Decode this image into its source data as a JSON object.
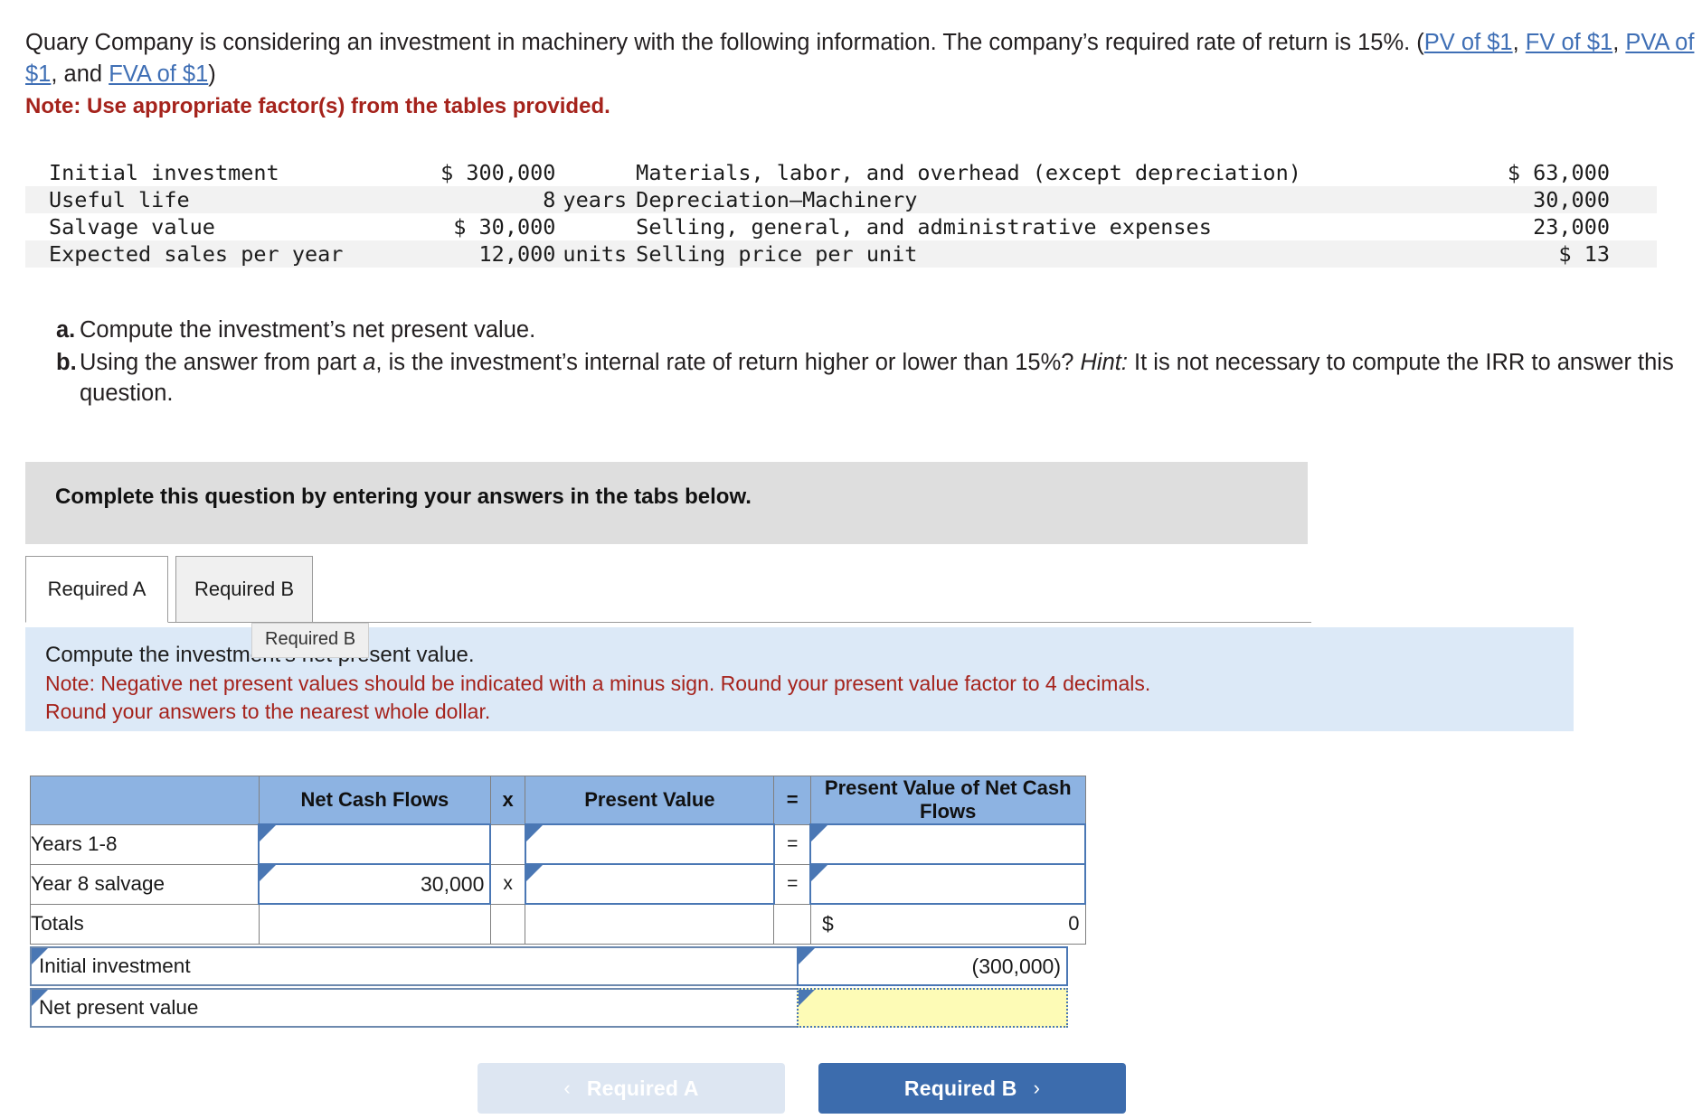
{
  "intro": {
    "part1": "Quary Company is considering an investment in machinery with the following information. The company’s required rate of return is 15%. (",
    "links": [
      "PV of $1",
      "FV of $1",
      "PVA of $1",
      "FVA of $1"
    ],
    "sep1": ", ",
    "sep2": ", ",
    "sep3": ", and ",
    "part2": ")",
    "note": "Note: Use appropriate factor(s) from the tables provided."
  },
  "facts": [
    {
      "label": "Initial investment",
      "value": "$ 300,000",
      "unit": "",
      "label2": "Materials, labor, and overhead (except depreciation)",
      "value2": "$ 63,000"
    },
    {
      "label": "Useful life",
      "value": "8",
      "unit": "years",
      "label2": "Depreciation—Machinery",
      "value2": "30,000"
    },
    {
      "label": "Salvage value",
      "value": "$ 30,000",
      "unit": "",
      "label2": "Selling, general, and administrative expenses",
      "value2": "23,000"
    },
    {
      "label": "Expected sales per year",
      "value": "12,000",
      "unit": "units",
      "label2": "Selling price per unit",
      "value2": "$ 13"
    }
  ],
  "questions": [
    {
      "mark": "a.",
      "text": "Compute the investment’s net present value."
    },
    {
      "mark": "b.",
      "text_pre": "Using the answer from part ",
      "em1": "a",
      "text_mid": ", is the investment’s internal rate of return higher or lower than 15%? ",
      "em2": "Hint:",
      "text_post": " It is not necessary to compute the IRR to answer this question."
    }
  ],
  "banner": {
    "text": "Complete this question by entering your answers in the tabs below."
  },
  "tabs": [
    {
      "label": "Required A",
      "active": true
    },
    {
      "label": "Required B",
      "active": false
    }
  ],
  "tooltip": {
    "text": "Required B"
  },
  "instructions": {
    "line1": "Compute the investment’s net present value.",
    "line2": "Note: Negative net present values should be indicated with a minus sign. Round your present value factor to 4 decimals.",
    "line3": "Round your answers to the nearest whole dollar."
  },
  "answer_grid": {
    "headers": [
      "",
      "Net Cash Flows",
      "x",
      "Present Value",
      "=",
      "Present Value of Net Cash Flows"
    ],
    "rows": [
      {
        "label": "Years 1-8",
        "net_cash_flows": "",
        "op1": "",
        "present_value": "",
        "op2": "=",
        "pv_net": ""
      },
      {
        "label": "Year 8 salvage",
        "net_cash_flows": "30,000",
        "op1": "x",
        "present_value": "",
        "op2": "=",
        "pv_net": ""
      }
    ],
    "totals": {
      "label": "Totals",
      "symbol": "$",
      "value": "0"
    },
    "initial_investment": {
      "label": "Initial investment",
      "value": "(300,000)"
    },
    "net_present_value": {
      "label": "Net present value",
      "value": ""
    }
  },
  "footer": {
    "prev_label": "Required A",
    "prev_chevron": "‹",
    "next_label": "Required B",
    "next_chevron": "›"
  },
  "colors": {
    "header_blue": "#8db3e2",
    "instruction_blue": "#dce9f7",
    "banner_grey": "#dedede",
    "note_red": "#a5231c",
    "link_blue": "#3f6fb5",
    "input_border": "#4a77b4",
    "highlight_yellow": "#fdfbb6",
    "primary_button": "#3c6cad"
  }
}
